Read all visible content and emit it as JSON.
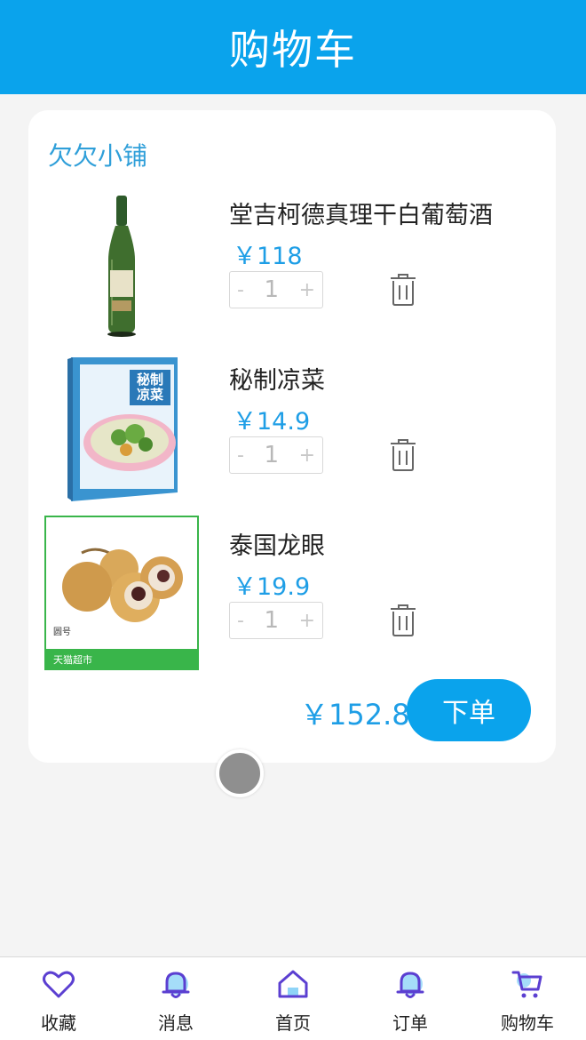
{
  "header": {
    "title": "购物车"
  },
  "shop": {
    "name": "欠欠小铺"
  },
  "items": [
    {
      "name": "堂吉柯德真理干白葡萄酒",
      "price": "￥118",
      "qty": "1",
      "minus": "-",
      "plus": "+",
      "thumb": "wine-bottle-image"
    },
    {
      "name": "秘制凉菜",
      "price": "￥14.9",
      "qty": "1",
      "minus": "-",
      "plus": "+",
      "thumb": "cold-dish-cookbook-image",
      "thumb_text": "秘制凉菜"
    },
    {
      "name": "泰国龙眼",
      "price": "￥19.9",
      "qty": "1",
      "minus": "-",
      "plus": "+",
      "thumb": "longan-fruit-image",
      "thumb_text_top": "圆号",
      "thumb_text_banner": "天猫超市"
    }
  ],
  "total": "￥152.8",
  "order_button": "下单",
  "tabbar": [
    {
      "label": "收藏",
      "icon": "heart-icon"
    },
    {
      "label": "消息",
      "icon": "bell-icon"
    },
    {
      "label": "首页",
      "icon": "home-icon"
    },
    {
      "label": "订单",
      "icon": "bell-icon"
    },
    {
      "label": "购物车",
      "icon": "cart-icon"
    }
  ],
  "colors": {
    "brand": "#0aa3ec",
    "price": "#1e9ee6",
    "shop": "#2f9fd9"
  }
}
